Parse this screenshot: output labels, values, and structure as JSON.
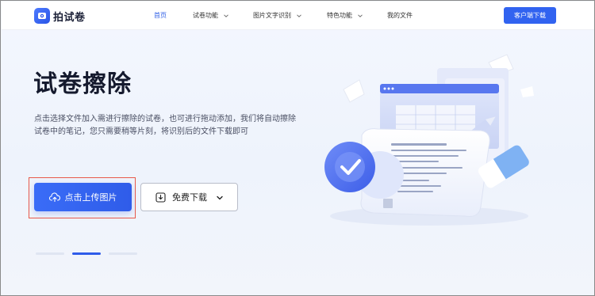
{
  "app": {
    "name": "拍试卷"
  },
  "nav": {
    "items": [
      {
        "label": "首页",
        "active": true,
        "has_dropdown": false
      },
      {
        "label": "试卷功能",
        "active": false,
        "has_dropdown": true
      },
      {
        "label": "图片文字识别",
        "active": false,
        "has_dropdown": true
      },
      {
        "label": "特色功能",
        "active": false,
        "has_dropdown": true
      },
      {
        "label": "我的文件",
        "active": false,
        "has_dropdown": false
      }
    ],
    "client_download": "客户端下载"
  },
  "hero": {
    "title": "试卷擦除",
    "description": "点击选择文件加入需进行擦除的试卷，也可进行拖动添加，我们将自动擦除试卷中的笔记，您只需要稍等片刻，将识别后的文件下载即可",
    "upload_button": "点击上传图片",
    "free_download_button": "免费下载"
  },
  "carousel": {
    "slides": 3,
    "active_index": 1
  },
  "colors": {
    "accent": "#3163f0",
    "highlight_border": "#e8594a",
    "title": "#151a2e"
  },
  "icons": {
    "logo": "logo-icon",
    "upload": "cloud-upload-icon",
    "download": "download-box-icon",
    "caret": "chevron-down-icon"
  }
}
